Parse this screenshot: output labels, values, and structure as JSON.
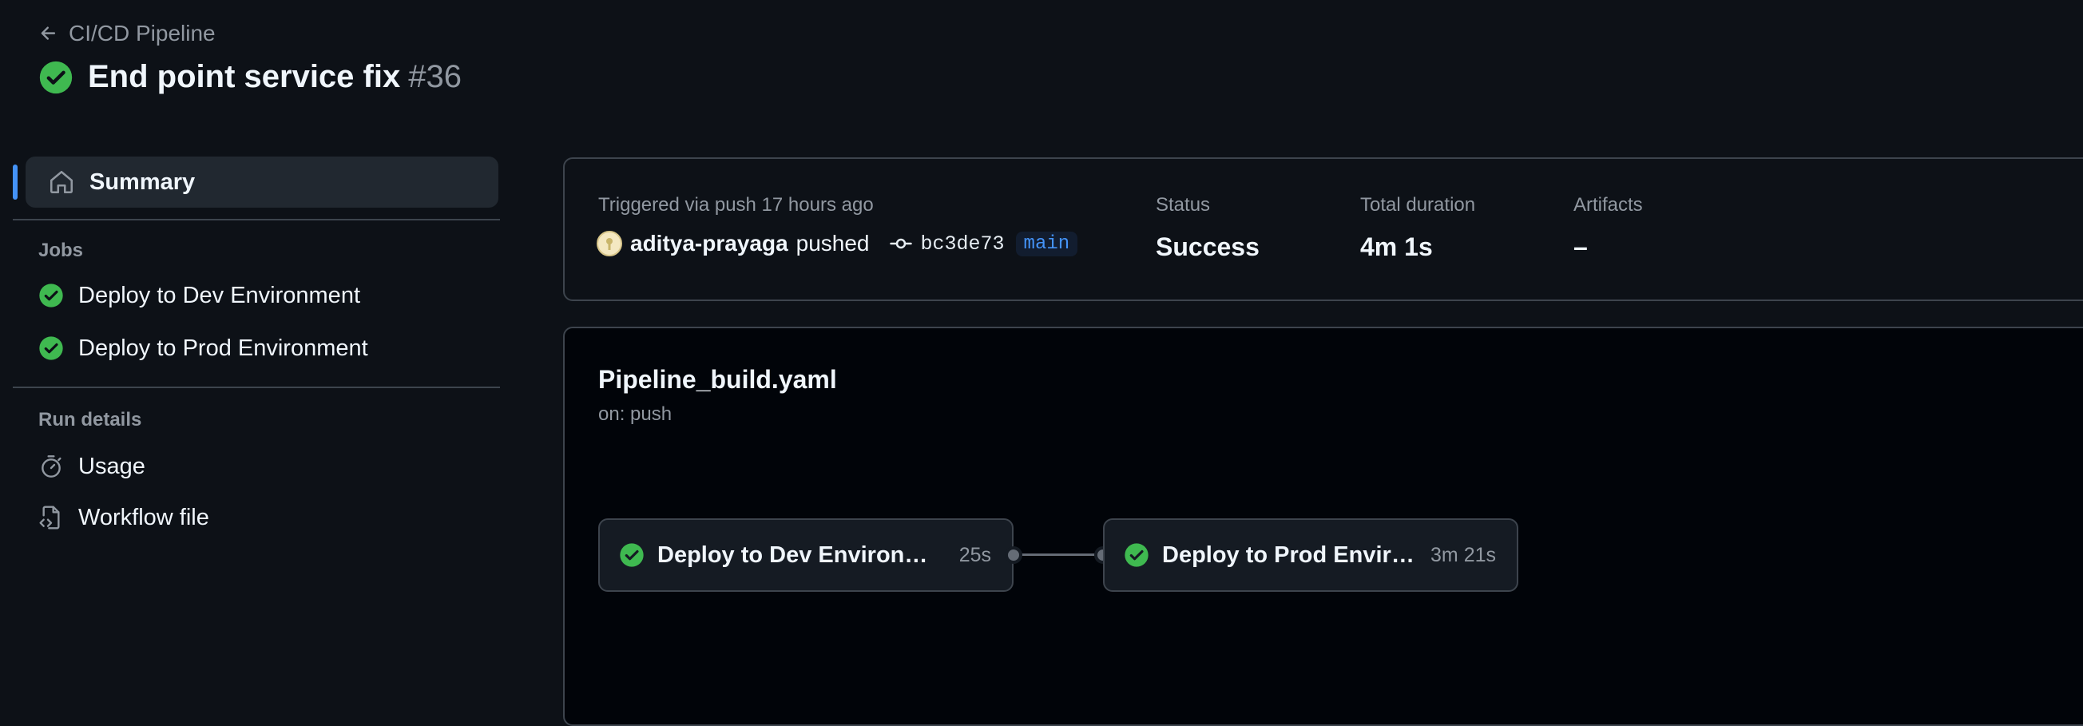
{
  "header": {
    "back_label": "CI/CD Pipeline",
    "run_title": "End point service fix",
    "run_number": "#36"
  },
  "sidebar": {
    "summary_label": "Summary",
    "jobs_heading": "Jobs",
    "jobs": [
      {
        "label": "Deploy to Dev Environment",
        "status": "success"
      },
      {
        "label": "Deploy to Prod Environment",
        "status": "success"
      }
    ],
    "run_details_heading": "Run details",
    "run_details": [
      {
        "label": "Usage",
        "icon": "stopwatch-icon"
      },
      {
        "label": "Workflow file",
        "icon": "file-code-icon"
      }
    ]
  },
  "summary": {
    "trigger_text": "Triggered via push 17 hours ago",
    "actor": "aditya-prayaga",
    "action": "pushed",
    "commit_sha": "bc3de73",
    "branch": "main",
    "status_label": "Status",
    "status_value": "Success",
    "duration_label": "Total duration",
    "duration_value": "4m 1s",
    "artifacts_label": "Artifacts",
    "artifacts_value": "–"
  },
  "workflow": {
    "file_name": "Pipeline_build.yaml",
    "trigger": "on: push",
    "jobs": [
      {
        "label": "Deploy to Dev Environment",
        "duration": "25s"
      },
      {
        "label": "Deploy to Prod Environment",
        "duration": "3m 21s"
      }
    ]
  },
  "colors": {
    "background": "#0d1117",
    "success": "#3fb950",
    "accent": "#4493f8",
    "border": "#3d444d"
  }
}
